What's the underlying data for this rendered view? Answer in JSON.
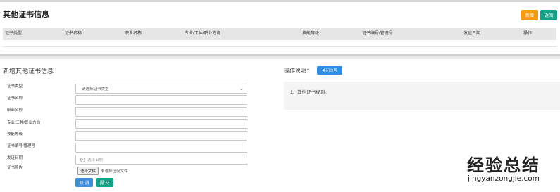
{
  "top_panel": {
    "title": "其他证书信息",
    "add_button": "新增",
    "back_button": "返回",
    "table_headers": [
      "证书类型",
      "证书名称",
      "职业名称",
      "专业/工种/职业方向",
      "技能等级",
      "证书编号/管理号",
      "发证日期",
      "操作"
    ]
  },
  "form": {
    "title": "新增其他证书信息",
    "labels": {
      "cert_type": "证书类型",
      "cert_name": "证书名称",
      "job_name": "职业名称",
      "specialty": "专业/工种/职业方向",
      "skill_level": "技能等级",
      "cert_number": "证书编号/管理号",
      "issue_date": "发证日期",
      "cert_photo": "证书照片"
    },
    "cert_type_placeholder": "请选择证书类型",
    "date_placeholder": "选择日期",
    "file_button": "选择文件",
    "file_status": "未选择任何文件",
    "cancel_button": "取 消",
    "submit_button": "提 交"
  },
  "ops": {
    "label": "操作说明：",
    "close_guide_button": "关闭向导",
    "items": [
      "1、其他证书规则。"
    ]
  },
  "watermark": {
    "text": "经验总结",
    "url": "jingyanzongjie.com"
  }
}
